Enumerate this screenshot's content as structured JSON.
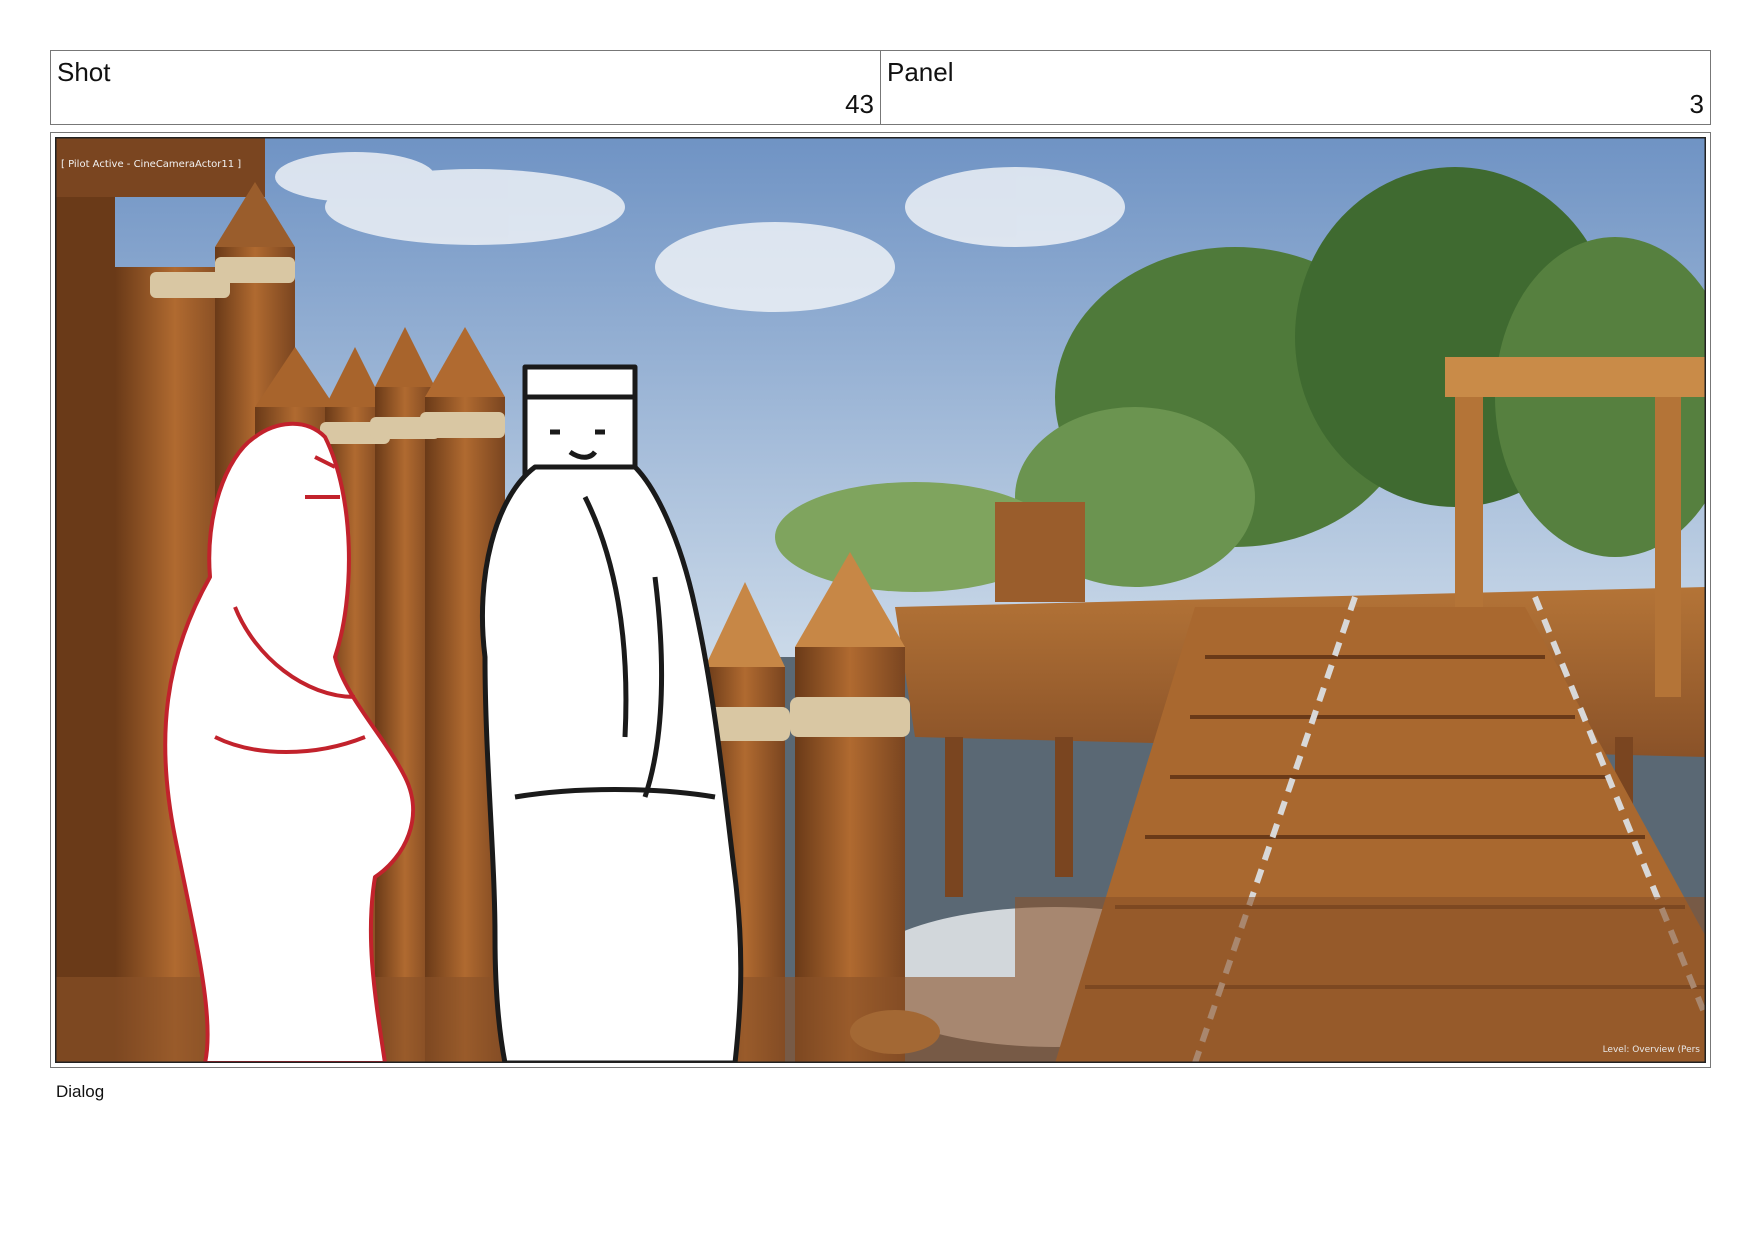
{
  "header": {
    "shot": {
      "label": "Shot",
      "value": "43"
    },
    "panel": {
      "label": "Panel",
      "value": "3"
    }
  },
  "viewport": {
    "pilot_label": "[ Pilot Active - CineCameraActor11 ]",
    "level_label": "Level:  Overview (Pers"
  },
  "footer": {
    "dialog_label": "Dialog"
  },
  "colors": {
    "sketch_red": "#c2222c",
    "sketch_black": "#1a1a1a",
    "wood": "#a8642c",
    "rope": "#d9c7a3"
  }
}
